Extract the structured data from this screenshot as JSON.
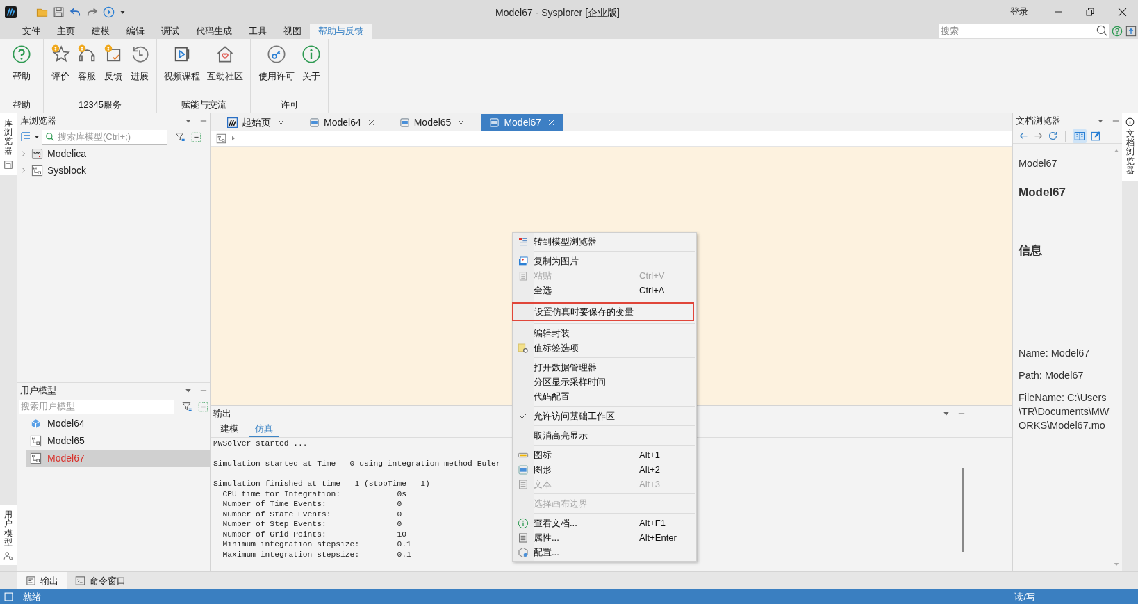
{
  "window": {
    "title": "Model67 - Sysplorer [企业版]",
    "login": "登录"
  },
  "menu_tabs": [
    {
      "label": "文件",
      "selected": false
    },
    {
      "label": "主页",
      "selected": false
    },
    {
      "label": "建模",
      "selected": false
    },
    {
      "label": "编辑",
      "selected": false
    },
    {
      "label": "调试",
      "selected": false
    },
    {
      "label": "代码生成",
      "selected": false
    },
    {
      "label": "工具",
      "selected": false
    },
    {
      "label": "视图",
      "selected": false
    },
    {
      "label": "帮助与反馈",
      "selected": true
    }
  ],
  "search": {
    "placeholder": "搜索"
  },
  "ribbon_groups": [
    {
      "label": "帮助",
      "buttons": [
        {
          "label": "帮助",
          "kind": "help"
        }
      ]
    },
    {
      "label": "12345服务",
      "buttons": [
        {
          "label": "评价",
          "kind": "star"
        },
        {
          "label": "客服",
          "kind": "headset"
        },
        {
          "label": "反馈",
          "kind": "feedback"
        },
        {
          "label": "进展",
          "kind": "history"
        }
      ]
    },
    {
      "label": "赋能与交流",
      "buttons": [
        {
          "label": "视频课程",
          "kind": "video"
        },
        {
          "label": "互动社区",
          "kind": "house"
        }
      ]
    },
    {
      "label": "许可",
      "buttons": [
        {
          "label": "使用许可",
          "kind": "key"
        },
        {
          "label": "关于",
          "kind": "info"
        }
      ]
    }
  ],
  "side_tabs_left": [
    {
      "label": "库浏览器",
      "selected": true
    },
    {
      "label": "用户模型",
      "selected": true
    }
  ],
  "library_browser": {
    "title": "库浏览器",
    "search_placeholder": "搜索库模型(Ctrl+;)",
    "tree": [
      {
        "label": "Modelica",
        "expanded": false,
        "kind": "modelica"
      },
      {
        "label": "Sysblock",
        "expanded": false,
        "kind": "block"
      }
    ]
  },
  "user_models": {
    "title": "用户模型",
    "search_placeholder": "搜索用户模型",
    "items": [
      {
        "label": "Model64",
        "selected": false,
        "kind": "cube"
      },
      {
        "label": "Model65",
        "selected": false,
        "kind": "block"
      },
      {
        "label": "Model67",
        "selected": true,
        "kind": "block"
      }
    ]
  },
  "editor_tabs": [
    {
      "label": "起始页",
      "selected": false,
      "kind": "start"
    },
    {
      "label": "Model64",
      "selected": false,
      "kind": "model"
    },
    {
      "label": "Model65",
      "selected": false,
      "kind": "model"
    },
    {
      "label": "Model67",
      "selected": true,
      "kind": "model"
    }
  ],
  "output": {
    "title": "输出",
    "tabs": [
      {
        "label": "建模",
        "selected": false
      },
      {
        "label": "仿真",
        "selected": true
      }
    ],
    "paragraphs": [
      [
        "MWSolver started ..."
      ],
      [
        "Simulation started at Time = 0 using integration method Euler"
      ],
      [
        "Simulation finished at time = 1 (stopTime = 1)",
        "  CPU time for Integration:            0s",
        "  Number of Time Events:               0",
        "  Number of State Events:              0",
        "  Number of Step Events:               0",
        "  Number of Grid Points:               10",
        "  Minimum integration stepsize:        0.1",
        "  Maximum integration stepsize:        0.1"
      ]
    ]
  },
  "context_menu": {
    "groups": [
      {
        "items": [
          {
            "label": "转到模型浏览器",
            "kind": "goto",
            "disabled": false,
            "checked": false,
            "highlighted": false
          }
        ]
      },
      {
        "items": [
          {
            "label": "复制为图片",
            "kind": "picture",
            "disabled": false,
            "checked": false,
            "highlighted": false
          },
          {
            "label": "粘贴",
            "shortcut": "Ctrl+V",
            "kind": "clipboard",
            "disabled": true,
            "checked": false,
            "highlighted": false
          },
          {
            "label": "全选",
            "shortcut": "Ctrl+A",
            "kind": "plain",
            "disabled": false,
            "checked": false,
            "highlighted": false
          }
        ]
      },
      {
        "items": [
          {
            "label": "设置仿真时要保存的变量",
            "kind": "plain",
            "disabled": false,
            "checked": false,
            "highlighted": true
          }
        ]
      },
      {
        "items": [
          {
            "label": "编辑封装",
            "kind": "plain",
            "disabled": false,
            "checked": false,
            "highlighted": false
          },
          {
            "label": "值标签选项",
            "kind": "labelgear",
            "disabled": false,
            "checked": false,
            "highlighted": false
          }
        ]
      },
      {
        "items": [
          {
            "label": "打开数据管理器",
            "kind": "plain",
            "disabled": false,
            "checked": false,
            "highlighted": false
          },
          {
            "label": "分区显示采样时间",
            "kind": "plain",
            "disabled": false,
            "checked": false,
            "highlighted": false
          },
          {
            "label": "代码配置",
            "kind": "plain",
            "disabled": false,
            "checked": false,
            "highlighted": false
          }
        ]
      },
      {
        "items": [
          {
            "label": "允许访问基础工作区",
            "kind": "plain",
            "disabled": false,
            "checked": true,
            "highlighted": false
          }
        ]
      },
      {
        "items": [
          {
            "label": "取消高亮显示",
            "kind": "plain",
            "disabled": false,
            "checked": false,
            "highlighted": false
          }
        ]
      },
      {
        "items": [
          {
            "label": "图标",
            "shortcut": "Alt+1",
            "kind": "iconview",
            "disabled": false,
            "checked": false,
            "highlighted": false
          },
          {
            "label": "图形",
            "shortcut": "Alt+2",
            "kind": "diagram",
            "disabled": false,
            "checked": false,
            "highlighted": false
          },
          {
            "label": "文本",
            "shortcut": "Alt+3",
            "kind": "text",
            "disabled": true,
            "checked": false,
            "highlighted": false
          }
        ]
      },
      {
        "items": [
          {
            "label": "选择画布边界",
            "kind": "plain",
            "disabled": true,
            "checked": false,
            "highlighted": false
          }
        ]
      },
      {
        "items": [
          {
            "label": "查看文档...",
            "shortcut": "Alt+F1",
            "kind": "info",
            "disabled": false,
            "checked": false,
            "highlighted": false
          },
          {
            "label": "属性...",
            "shortcut": "Alt+Enter",
            "kind": "props",
            "disabled": false,
            "checked": false,
            "highlighted": false
          },
          {
            "label": "配置...",
            "kind": "config",
            "disabled": false,
            "checked": false,
            "highlighted": false
          }
        ]
      }
    ]
  },
  "doc_browser": {
    "title": "文档浏览器",
    "model_name": "Model67",
    "heading": "Model67",
    "section": "信息",
    "info": [
      "Name: Model67",
      "Path: Model67",
      "FileName: C:\\Users\\TR\\Documents\\MWORKS\\Model67.mo"
    ]
  },
  "side_tabs_right": [
    {
      "label": "文档浏览器",
      "selected": true
    }
  ],
  "bottom_tabs": [
    {
      "label": "输出",
      "selected": true,
      "kind": "output"
    },
    {
      "label": "命令窗口",
      "selected": false,
      "kind": "terminal"
    }
  ],
  "status_bar": {
    "left": "就绪",
    "right": "读/写"
  }
}
